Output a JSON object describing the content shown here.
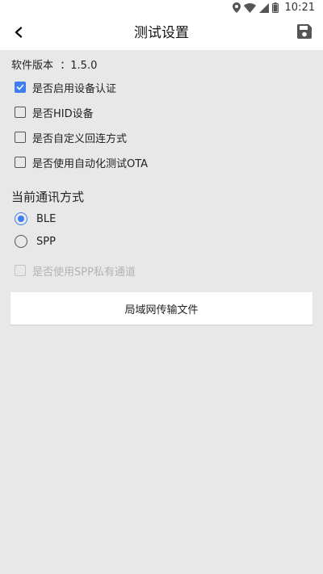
{
  "status_bar": {
    "time": "10:21",
    "icons": [
      "location-icon",
      "wifi-icon",
      "signal-icon",
      "battery-icon"
    ]
  },
  "app_bar": {
    "title": "测试设置",
    "back_icon": "back-arrow-icon",
    "save_icon": "save-icon"
  },
  "version": {
    "text": "软件版本  ：1.5.0"
  },
  "options": [
    {
      "label": "是否启用设备认证",
      "checked": true,
      "enabled": true
    },
    {
      "label": "是否HID设备",
      "checked": false,
      "enabled": true
    },
    {
      "label": "是否自定义回连方式",
      "checked": false,
      "enabled": true
    },
    {
      "label": "是否使用自动化测试OTA",
      "checked": false,
      "enabled": true
    }
  ],
  "comm": {
    "title": "当前通讯方式",
    "modes": [
      {
        "label": "BLE",
        "selected": true
      },
      {
        "label": "SPP",
        "selected": false
      }
    ]
  },
  "spp_private": {
    "label": "是否使用SPP私有通道",
    "checked": false,
    "enabled": false
  },
  "lan_button": {
    "label": "局域网传输文件"
  },
  "colors": {
    "accent": "#3e7ef0",
    "background": "#e8e8e8",
    "surface": "#ffffff",
    "disabled": "#b3b3b3"
  }
}
